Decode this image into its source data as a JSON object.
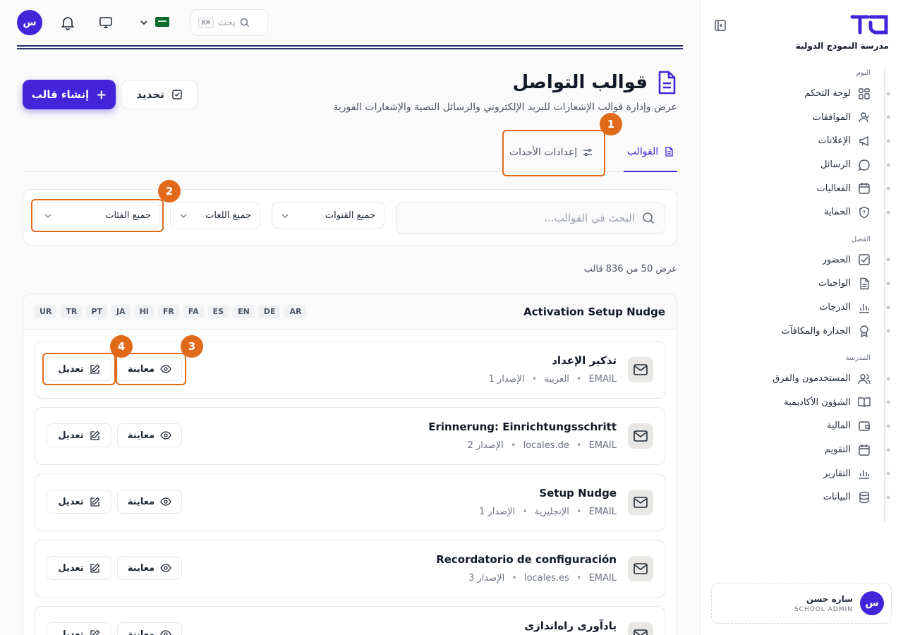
{
  "brand": {
    "name": "مدرسة النموذج الدولية"
  },
  "sidebar": {
    "groups": [
      {
        "title": "اليوم",
        "items": [
          {
            "label": "لوحة التحكم",
            "icon": "dashboard-icon"
          },
          {
            "label": "الموافقات",
            "icon": "user-check-icon"
          },
          {
            "label": "الإعلانات",
            "icon": "megaphone-icon"
          },
          {
            "label": "الرسائل",
            "icon": "chat-icon"
          },
          {
            "label": "الفعاليات",
            "icon": "calendar-icon"
          },
          {
            "label": "الحماية",
            "icon": "shield-icon"
          }
        ]
      },
      {
        "title": "الفصل",
        "items": [
          {
            "label": "الحضور",
            "icon": "checkbox-icon"
          },
          {
            "label": "الواجبات",
            "icon": "document-icon"
          },
          {
            "label": "الدرجات",
            "icon": "chart-icon"
          },
          {
            "label": "الجدارة والمكافآت",
            "icon": "award-icon"
          }
        ]
      },
      {
        "title": "المدرسة",
        "items": [
          {
            "label": "المستخدمون والفرق",
            "icon": "users-icon"
          },
          {
            "label": "الشؤون الأكاديمية",
            "icon": "book-icon"
          },
          {
            "label": "المالية",
            "icon": "wallet-icon"
          },
          {
            "label": "التقويم",
            "icon": "calendar-icon"
          },
          {
            "label": "التقارير",
            "icon": "chart-icon"
          },
          {
            "label": "البيانات",
            "icon": "database-icon"
          }
        ]
      }
    ]
  },
  "user": {
    "initial": "س",
    "name": "سارة حسن",
    "role": "SCHOOL ADMIN"
  },
  "topbar": {
    "avatar_initial": "س",
    "search_placeholder": "بحث",
    "shortcut": "K⌘"
  },
  "header": {
    "title": "قوالب التواصل",
    "subtitle": "عرض وإدارة قوالب الإشعارات للبريد الإلكتروني والرسائل النصية والإشعارات الفورية",
    "create_label": "إنشاء قالب",
    "select_label": "تحديد"
  },
  "tabs": {
    "templates": "القوالب",
    "events": "إعدادات الأحداث"
  },
  "filters": {
    "search_placeholder": "البحث في القوالب...",
    "channels": "جميع القنوات",
    "languages": "جميع اللغات",
    "categories": "جميع الفئات"
  },
  "count_text": "عرض 50 من 836 قالب",
  "group": {
    "title": "Activation Setup Nudge",
    "languages": [
      "AR",
      "DE",
      "EN",
      "ES",
      "FA",
      "FR",
      "HI",
      "JA",
      "PT",
      "TR",
      "UR"
    ]
  },
  "templates": [
    {
      "name": "تذكير الإعداد",
      "channel": "EMAIL",
      "locale": "العربية",
      "version": "الإصدار 1"
    },
    {
      "name": "Erinnerung: Einrichtungsschritt",
      "channel": "EMAIL",
      "locale": "locales.de",
      "version": "الإصدار 2"
    },
    {
      "name": "Setup Nudge",
      "channel": "EMAIL",
      "locale": "الإنجليزية",
      "version": "الإصدار 1"
    },
    {
      "name": "Recordatorio de configuración",
      "channel": "EMAIL",
      "locale": "locales.es",
      "version": "الإصدار 3"
    },
    {
      "name": "یادآوری راه‌اندازی",
      "channel": "EMAIL",
      "locale": "",
      "version": ""
    }
  ],
  "actions": {
    "preview": "معاينة",
    "edit": "تعديل"
  },
  "badges": [
    "1",
    "2",
    "3",
    "4"
  ],
  "colors": {
    "accent": "#4324d8",
    "highlight": "#e06a1a"
  }
}
